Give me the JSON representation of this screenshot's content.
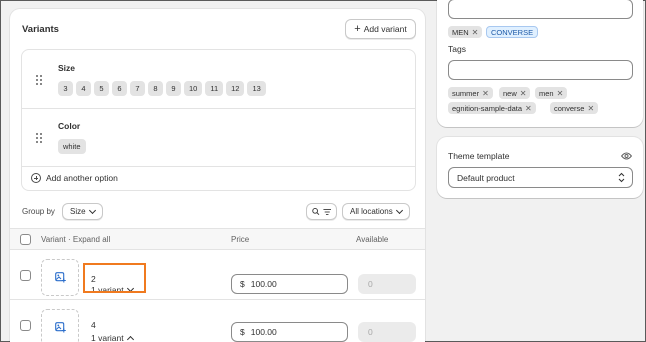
{
  "variants": {
    "title": "Variants",
    "add_variant_label": "Add variant",
    "options": [
      {
        "name": "Size",
        "values": [
          "3",
          "4",
          "5",
          "6",
          "7",
          "8",
          "9",
          "10",
          "11",
          "12",
          "13"
        ]
      },
      {
        "name": "Color",
        "values": [
          "white"
        ]
      }
    ],
    "add_option_label": "Add another option",
    "group_by_label": "Group by",
    "group_by_value": "Size",
    "locations_label": "All locations",
    "table": {
      "col_variant": "Variant · Expand all",
      "col_price": "Price",
      "col_available": "Available",
      "rows": [
        {
          "name": "2",
          "count": "1 variant",
          "currency": "$",
          "price": "100.00",
          "available": "0"
        },
        {
          "name": "4",
          "count": "1 variant",
          "currency": "$",
          "price": "100.00",
          "available": "0"
        }
      ]
    }
  },
  "sidebar": {
    "tags_top": [
      {
        "label": "MEN",
        "style": "gray"
      },
      {
        "label": "CONVERSE",
        "style": "blue"
      }
    ],
    "tags_label": "Tags",
    "tags": [
      "summer",
      "new",
      "men",
      "egnition-sample-data",
      "converse"
    ],
    "theme_label": "Theme template",
    "theme_value": "Default product"
  },
  "colors": {
    "highlight": "#f07a1f",
    "tag_blue_bg": "#e0f0ff",
    "tag_blue_text": "#1e5aa8"
  }
}
